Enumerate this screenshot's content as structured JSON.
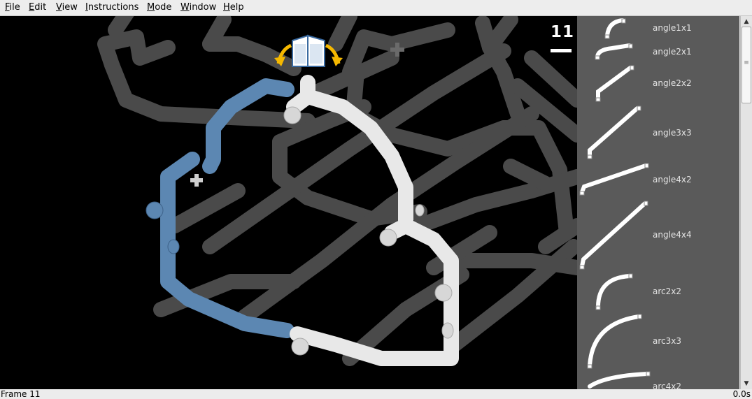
{
  "menu": {
    "items": [
      {
        "mnemonic": "F",
        "rest": "ile"
      },
      {
        "mnemonic": "E",
        "rest": "dit"
      },
      {
        "mnemonic": "V",
        "rest": "iew"
      },
      {
        "mnemonic": "I",
        "rest": "nstructions"
      },
      {
        "mnemonic": "M",
        "rest": "ode"
      },
      {
        "mnemonic": "W",
        "rest": "indow"
      },
      {
        "mnemonic": "H",
        "rest": "elp"
      }
    ]
  },
  "viewport": {
    "frame_number": "11",
    "colors": {
      "background": "#000000",
      "existing_pipe": "#4a4a4a",
      "selected_piece": "#e8e8e8",
      "highlighted_piece": "#5c87b2",
      "rotate_arrows": "#f5b800"
    },
    "icons": {
      "rotate_control": "book-rotate-icon"
    }
  },
  "palette": {
    "background": "#5a5a5a",
    "parts": [
      {
        "label": "angle1x1"
      },
      {
        "label": "angle2x1"
      },
      {
        "label": "angle2x2"
      },
      {
        "label": "angle3x3"
      },
      {
        "label": "angle4x2"
      },
      {
        "label": "angle4x4"
      },
      {
        "label": "arc2x2"
      },
      {
        "label": "arc3x3"
      },
      {
        "label": "arc4x2"
      }
    ]
  },
  "status": {
    "frame_text": "Frame 11",
    "time_text": "0.0s"
  }
}
